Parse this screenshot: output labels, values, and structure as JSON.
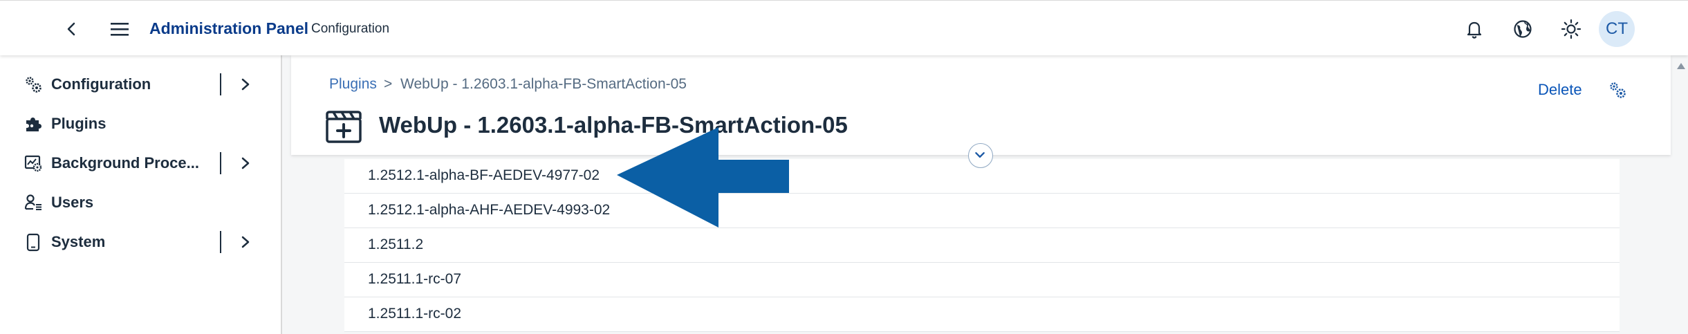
{
  "header": {
    "app_title": "Administration Panel",
    "app_subtitle": "Configuration",
    "avatar_initials": "CT"
  },
  "sidebar": {
    "items": [
      {
        "label": "Configuration",
        "icon": "gears-icon",
        "expandable": true
      },
      {
        "label": "Plugins",
        "icon": "puzzle-icon",
        "expandable": false
      },
      {
        "label": "Background Proce...",
        "icon": "background-process-icon",
        "expandable": true
      },
      {
        "label": "Users",
        "icon": "users-icon",
        "expandable": false
      },
      {
        "label": "System",
        "icon": "device-icon",
        "expandable": true
      }
    ]
  },
  "breadcrumb": {
    "link": "Plugins",
    "separator": ">",
    "current": "WebUp - 1.2603.1-alpha-FB-SmartAction-05"
  },
  "object": {
    "title": "WebUp - 1.2603.1-alpha-FB-SmartAction-05",
    "delete_label": "Delete"
  },
  "versions": [
    "1.2512.1-alpha-BF-AEDEV-4977-02",
    "1.2512.1-alpha-AHF-AEDEV-4993-02",
    "1.2511.2",
    "1.2511.1-rc-07",
    "1.2511.1-rc-02"
  ],
  "colors": {
    "brand_title": "#0a3b8a",
    "link": "#3a6fb5",
    "annotation_arrow": "#0b5fa5",
    "avatar_bg": "#dbeaf8"
  }
}
